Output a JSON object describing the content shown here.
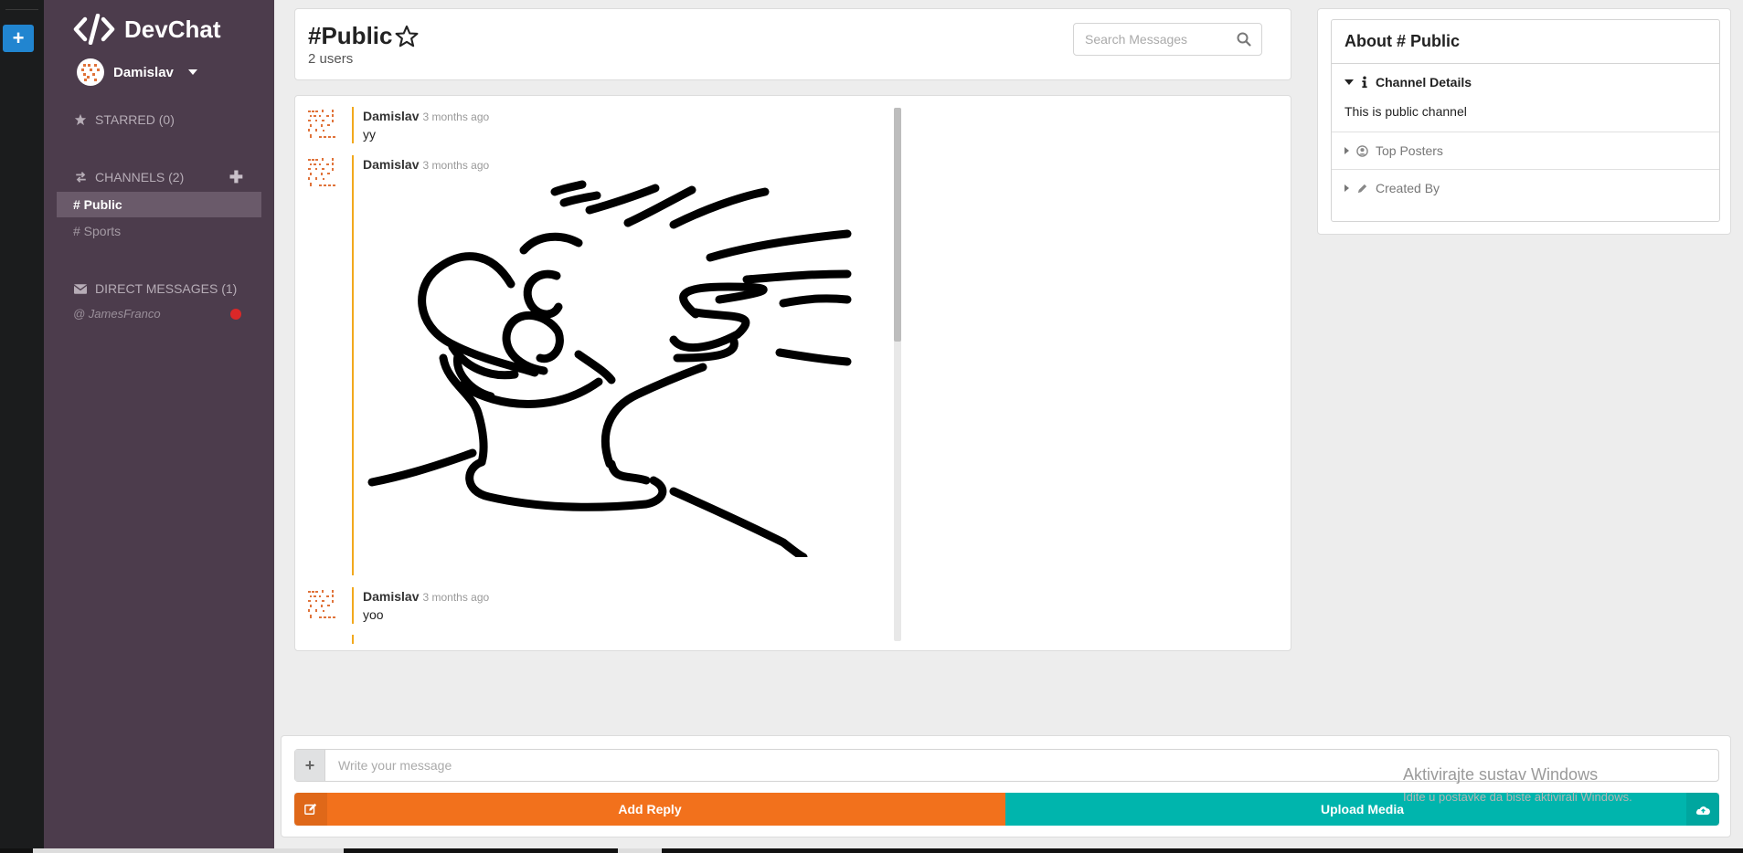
{
  "app": {
    "name": "DevChat",
    "accent": "#2185d0"
  },
  "rail": {
    "add_label": "+"
  },
  "user": {
    "name": "Damislav"
  },
  "sidebar": {
    "starred": {
      "label": "STARRED (0)"
    },
    "channels": {
      "label": "CHANNELS (2)",
      "items": [
        {
          "label": "# Public",
          "active": true
        },
        {
          "label": "# Sports",
          "active": false
        }
      ]
    },
    "direct_messages": {
      "label": "DIRECT MESSAGES (1)",
      "items": [
        {
          "label": "@ JamesFranco",
          "status_color": "#db2828"
        }
      ]
    }
  },
  "header": {
    "channel_title": "#Public",
    "user_count": "2 users",
    "search_placeholder": "Search Messages"
  },
  "messages": [
    {
      "author": "Damislav",
      "time": "3 months ago",
      "text": "yy"
    },
    {
      "author": "Damislav",
      "time": "3 months ago",
      "text": "",
      "image": "hand-drawing"
    },
    {
      "author": "Damislav",
      "time": "3 months ago",
      "text": "yoo"
    }
  ],
  "about": {
    "title": "About # Public",
    "sections": [
      {
        "label": "Channel Details",
        "open": true,
        "body": "This is public channel",
        "icon": "info-icon"
      },
      {
        "label": "Top Posters",
        "open": false,
        "icon": "user-circle-icon"
      },
      {
        "label": "Created By",
        "open": false,
        "icon": "pencil-icon"
      }
    ]
  },
  "composer": {
    "placeholder": "Write your message",
    "reply_label": "Add Reply",
    "upload_label": "Upload Media",
    "reply_color": "#f2711c",
    "upload_color": "#00b5ad"
  },
  "watermark": {
    "line1": "Aktivirajte sustav Windows",
    "line2": "Idite u postavke da biste aktivirali Windows."
  }
}
